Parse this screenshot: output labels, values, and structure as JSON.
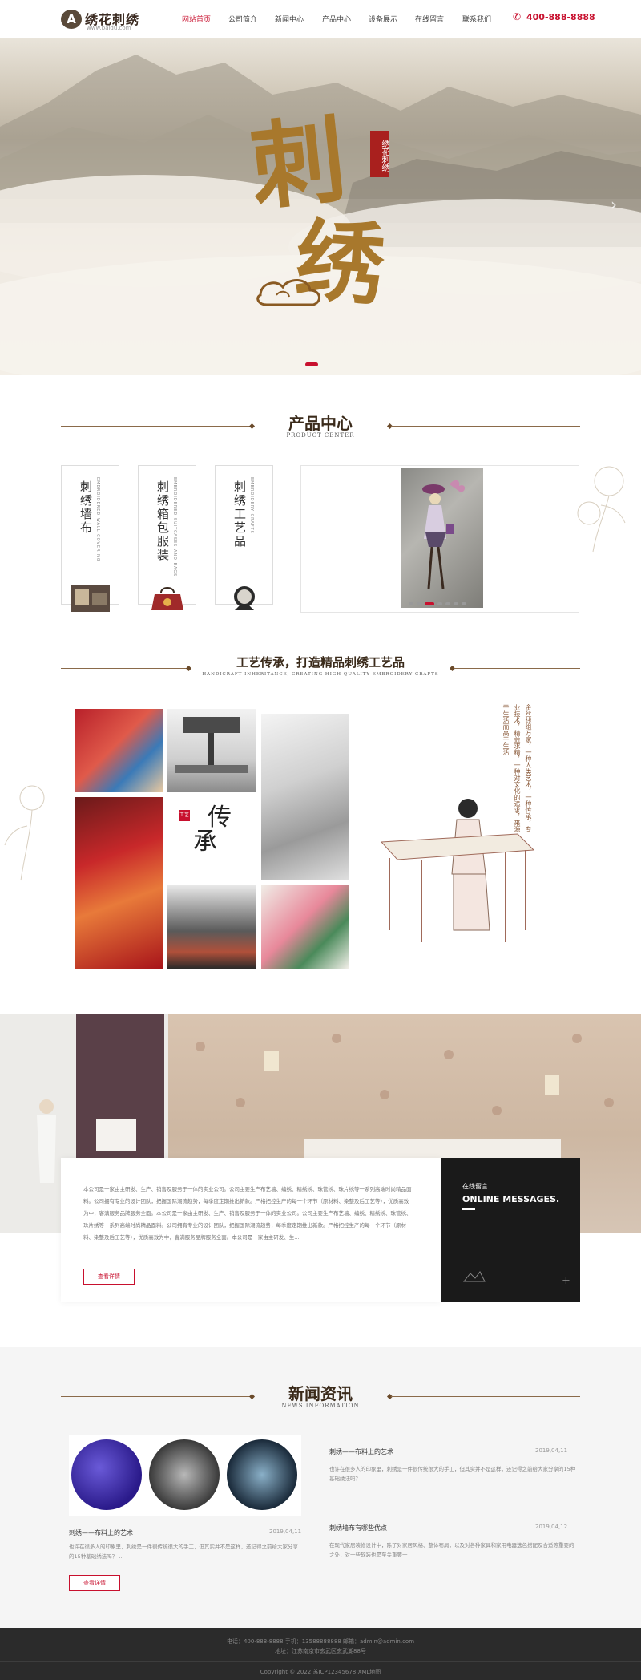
{
  "header": {
    "logo_mark": "A",
    "logo_text": "绣花刺绣",
    "logo_sub": "www.baidu.com",
    "nav": [
      "网站首页",
      "公司简介",
      "新闻中心",
      "产品中心",
      "设备展示",
      "在线留言",
      "联系我们"
    ],
    "phone": "400-888-8888",
    "accent": "#c8102e"
  },
  "banner": {
    "char1": "刺",
    "char2": "绣",
    "seal": "绣花刺绣"
  },
  "product_center": {
    "title": "产品中心",
    "subtitle": "PRODUCT CENTER",
    "categories": [
      {
        "title": "刺绣墙布",
        "en": "EMBROIDERED WALL COVERING"
      },
      {
        "title": "刺绣箱包服装",
        "en": "EMBROIDERED SUITCASES AND BAGS"
      },
      {
        "title": "刺绣工艺品",
        "en": "EMBROIDERY CRAFTS"
      }
    ]
  },
  "craft": {
    "title": "工艺传承，打造精品刺绣工艺品",
    "subtitle": "HANDICRAFT INHERITANCE, CREATING HIGH-QUALITY EMBROIDERY CRAFTS",
    "inherit_char1": "传",
    "inherit_char2": "承",
    "inherit_seal": "工艺",
    "side_text": "金丝线组万家，一种人类艺术，一种传承，专业技术，精益求精，一种对文化的追求，来源于生活而高于生活"
  },
  "about": {
    "text": "本公司是一家由主研发、生产、销售及服务于一体的实业公司。公司主要生产布艺墙、编绣、精绣绣、珠管绣、珠片绣等一系列高端时尚精品面料。公司拥有专业的设计团队，把握国际潮流趋势，每季度定期推出新款。严格把控生产的每一个环节（原材料、染整及后工艺等），优质高效为中，客满服务品牌服务全面。本公司是一家由主研发、生产、销售及服务于一体的实业公司。公司主要生产布艺墙、编绣、精绣绣、珠管绣、珠片绣等一系列高端时尚精品面料。公司拥有专业的设计团队，把握国际潮流趋势，每季度定期推出新款。严格把控生产的每一个环节（原材料、染整及后工艺等），优质高效为中，客满服务品牌服务全面。本公司是一家由主研发、生...",
    "button": "查看详情"
  },
  "message": {
    "title": "在线留言",
    "subtitle": "ONLINE MESSAGES.",
    "plus": "+"
  },
  "news": {
    "title": "新闻资讯",
    "subtitle": "NEWS INFORMATION",
    "main": {
      "title": "刺绣——布料上的艺术",
      "date": "2019,04,11",
      "desc": "也许在很多人的印象里，刺绣是一件很传统很大的手工，但其实并不是这样，还记得之前给大家分享的15种基础绣法吗？ ...",
      "button": "查看详情"
    },
    "items": [
      {
        "title": "刺绣——布料上的艺术",
        "date": "2019,04,11",
        "desc": "也许在很多人的印象里，刺绣是一件很传统很大的手工，但其实并不是这样，还记得之前给大家分享的15种基础绣法吗？ ..."
      },
      {
        "title": "刺绣墙布有哪些优点",
        "date": "2019,04,12",
        "desc": "在现代家居装修设计中，除了对家居风格、整体布局，以及对各种家具和家用电器选色搭配及合适等重要的之外，对一些软装也是至关重要一"
      }
    ]
  },
  "footer": {
    "line1": "电话：400-888-8888  手机：13588888888  邮箱：admin@admin.com",
    "line2": "地址：江苏南京市玄武区玄武湖88号",
    "copy": "Copyright © 2022  苏ICP12345678 XML地图"
  }
}
